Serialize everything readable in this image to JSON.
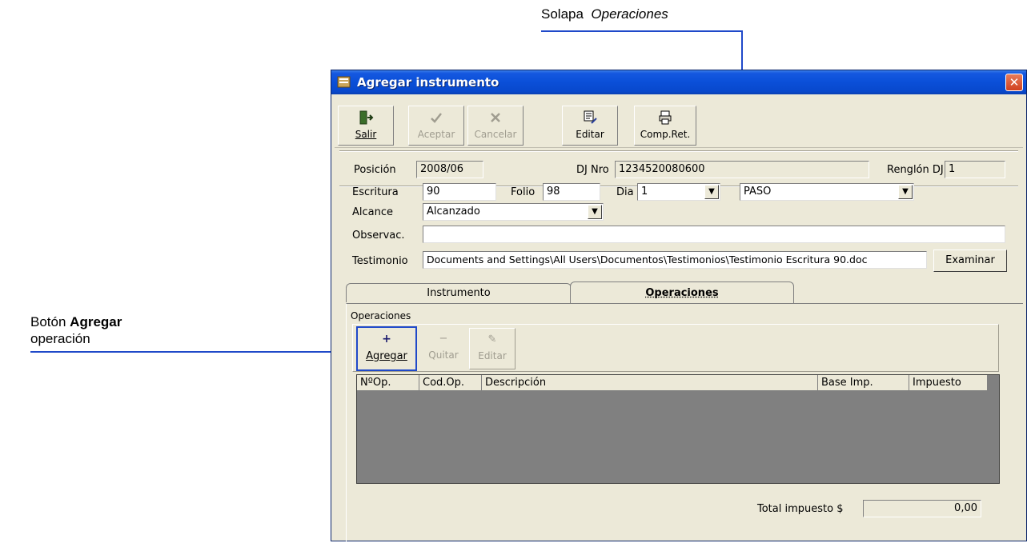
{
  "annotations": {
    "tab_label_prefix": "Solapa",
    "tab_label_name": "Operaciones",
    "button_label_prefix": "Botón",
    "button_label_bold": "Agregar",
    "button_label_suffix": "operación"
  },
  "window": {
    "title": "Agregar instrumento",
    "close_glyph": "✕"
  },
  "toolbar": {
    "buttons": [
      {
        "label": "Salir",
        "icon": "exit-door-icon",
        "enabled": true
      },
      {
        "label": "Aceptar",
        "icon": "checkmark-icon",
        "enabled": false
      },
      {
        "label": "Cancelar",
        "icon": "x-cancel-icon",
        "enabled": false
      },
      {
        "label": "Editar",
        "icon": "edit-icon",
        "enabled": true
      },
      {
        "label": "Comp.Ret.",
        "icon": "printer-icon",
        "enabled": true
      }
    ]
  },
  "header": {
    "posicion_label": "Posición",
    "posicion_value": "2008/06",
    "djnro_label": "DJ Nro",
    "djnro_value": "1234520080600",
    "renglon_label": "Renglón DJ",
    "renglon_value": "1"
  },
  "form": {
    "escritura_label": "Escritura",
    "escritura_value": "90",
    "folio_label": "Folio",
    "folio_value": "98",
    "dia_label": "Dia",
    "dia_value": "1",
    "tipo_value": "PASO",
    "alcance_label": "Alcance",
    "alcance_value": "Alcanzado",
    "observ_label": "Observac.",
    "observ_value": "",
    "testimonio_label": "Testimonio",
    "testimonio_value": "Documents and Settings\\All Users\\Documentos\\Testimonios\\Testimonio Escritura 90.doc",
    "examinar_label": "Examinar"
  },
  "tabs": [
    {
      "label": "Instrumento",
      "active": false
    },
    {
      "label": "Operaciones",
      "active": true
    }
  ],
  "operaciones": {
    "group_label": "Operaciones",
    "buttons": [
      {
        "label": "Agregar",
        "glyph": "+",
        "enabled": true
      },
      {
        "label": "Quitar",
        "glyph": "−",
        "enabled": false
      },
      {
        "label": "Editar",
        "glyph": "✎",
        "enabled": false
      }
    ],
    "columns": [
      "NºOp.",
      "Cod.Op.",
      "Descripción",
      "Base Imp.",
      "Impuesto"
    ],
    "rows": [],
    "total_label": "Total impuesto $",
    "total_value": "0,00"
  },
  "colors": {
    "annotation_line": "#1f49c9",
    "annotation_dot": "#1a3fd8",
    "titlebar": "#0a4fd8",
    "grid_bg": "#808080"
  }
}
